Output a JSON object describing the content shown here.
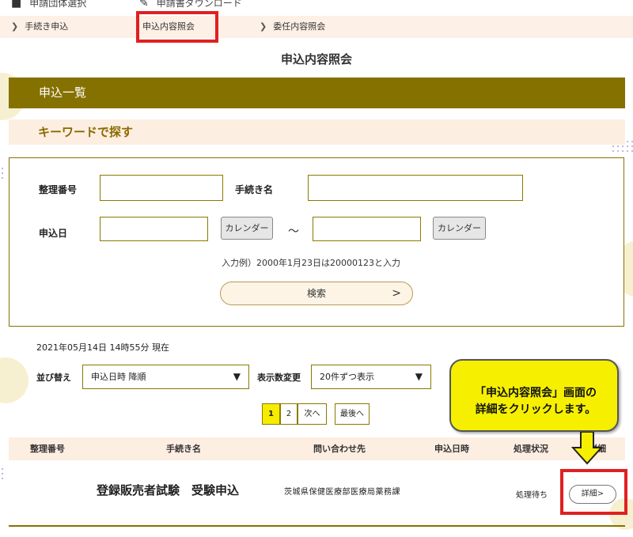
{
  "top_nav": {
    "group_select": {
      "label": "申請団体選択",
      "icon": "group-icon"
    },
    "download": {
      "label": "申請書ダウンロード",
      "icon": "edit-icon"
    }
  },
  "breadcrumb": {
    "items": [
      {
        "label": "手続き申込"
      },
      {
        "label": "申込内容照会"
      },
      {
        "label": "委任内容照会"
      }
    ]
  },
  "page_title": "申込内容照会",
  "section_title": "申込一覧",
  "keyword_title": "キーワードで探す",
  "search": {
    "seiri_label": "整理番号",
    "seiri_value": "",
    "tetsuzuki_label": "手続き名",
    "tetsuzuki_value": "",
    "date_label": "申込日",
    "date_from_value": "",
    "date_to_value": "",
    "calendar_label": "カレンダー",
    "tilde": "～",
    "hint": "入力例）2000年1月23日は20000123と入力",
    "search_button": "検索",
    "search_arrow": ">"
  },
  "timestamp": "2021年05月14日 14時55分 現在",
  "controls": {
    "sort_label": "並び替え",
    "sort_value": "申込日時 降順",
    "display_label": "表示数変更",
    "display_value": "20件ずつ表示",
    "caret": "▼"
  },
  "pager": {
    "pages": [
      "1",
      "2"
    ],
    "next": "次へ",
    "last": "最後へ",
    "current_page": "1"
  },
  "table": {
    "headers": [
      "整理番号",
      "手続き名",
      "問い合わせ先",
      "申込日時",
      "処理状況",
      "詳細"
    ],
    "rows": [
      {
        "seiri": "",
        "procedure": "登録販売者試験　受験申込",
        "contact": "茨城県保健医療部医療局薬務課",
        "date": "",
        "status": "処理待ち",
        "detail_button": "詳細>"
      }
    ]
  },
  "callout": {
    "line1": "「申込内容照会」画面の",
    "line2": "詳細をクリックします。"
  },
  "colors": {
    "olive": "#857100",
    "highlight_red": "#e02020",
    "callout_yellow": "#f6f000",
    "band_peach": "#fdeee2"
  }
}
